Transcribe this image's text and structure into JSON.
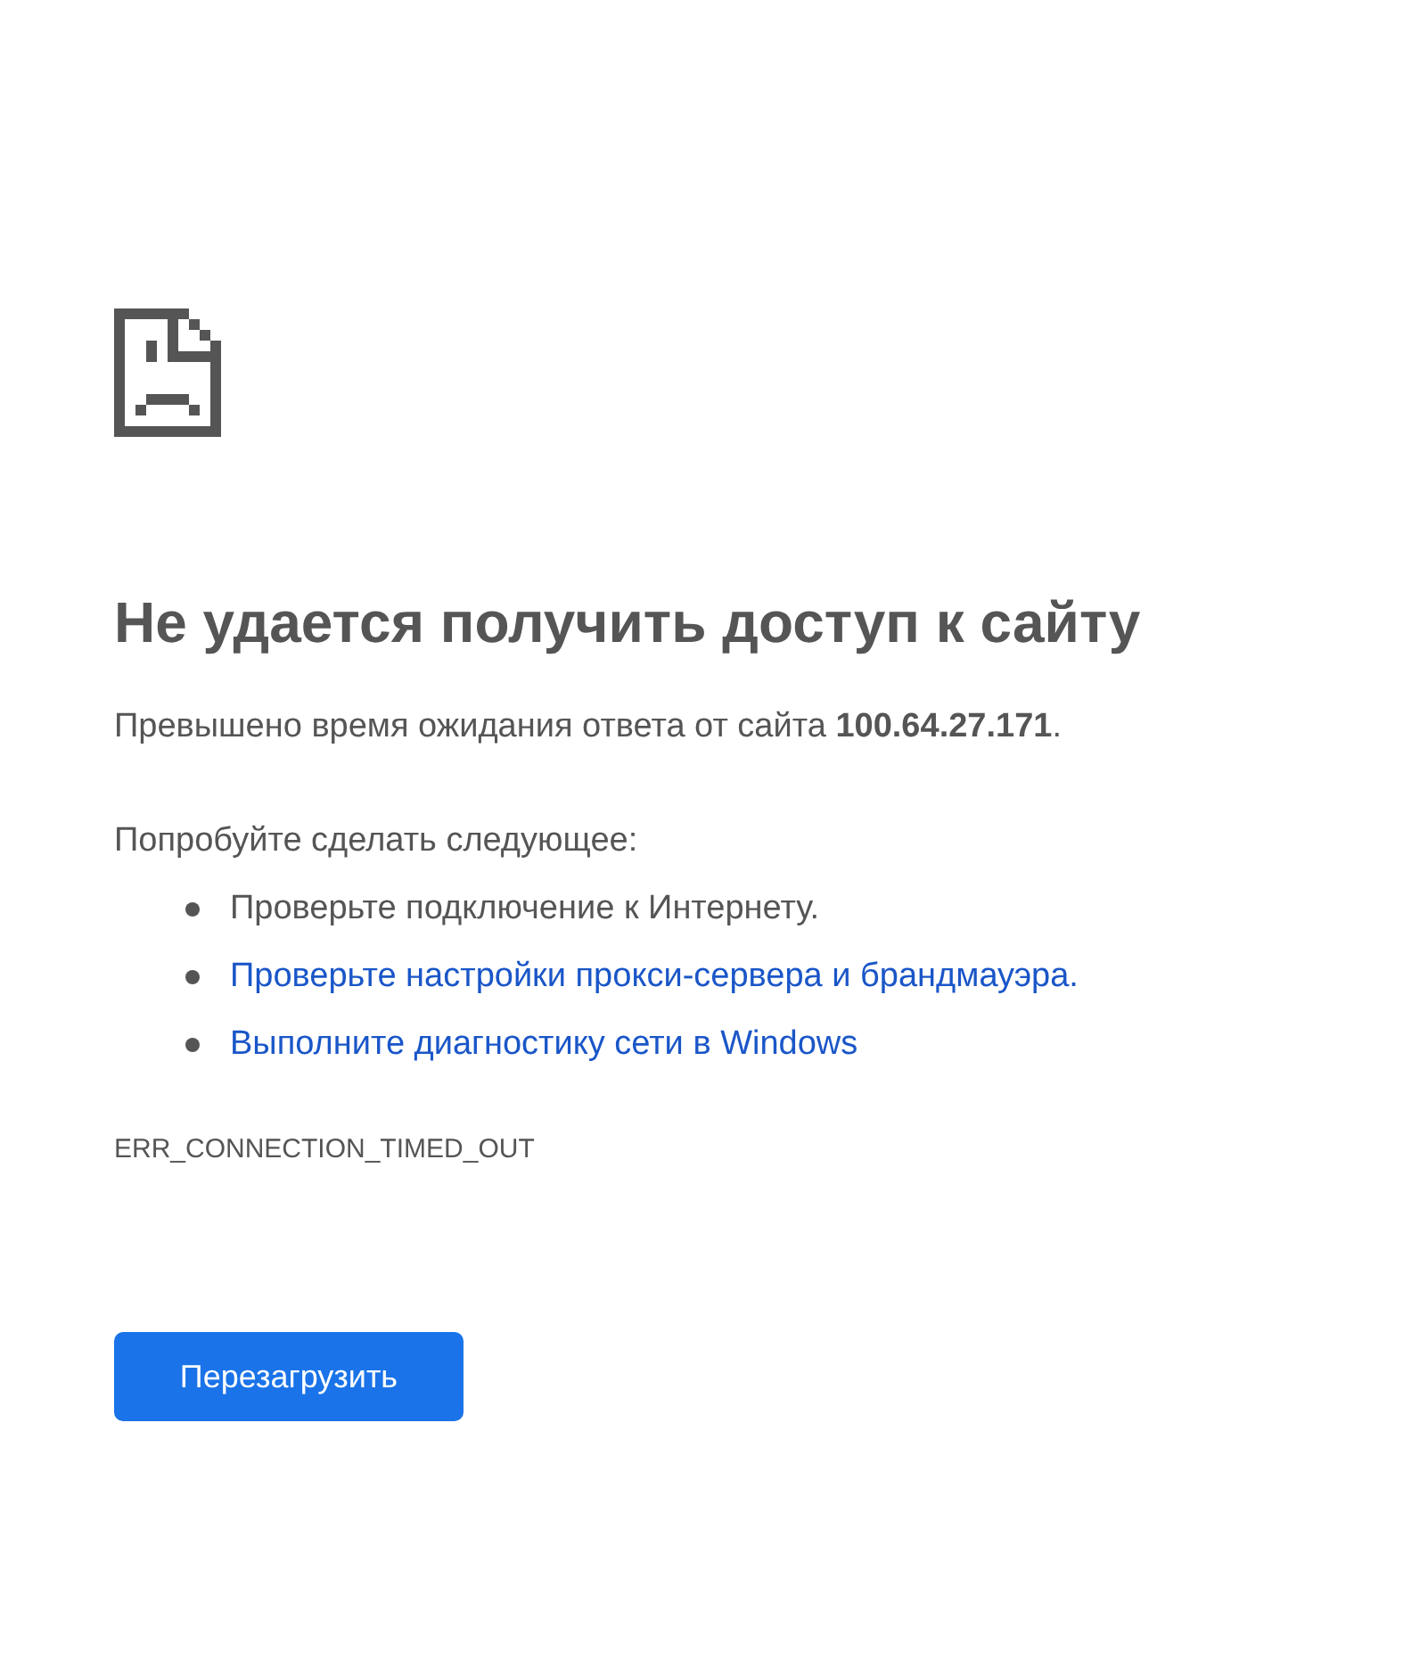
{
  "title": "Не удается получить доступ к сайту",
  "message": "Превышено время ожидания ответа от сайта **100.64.27.171**.",
  "suggestions_heading": "Попробуйте сделать следующее:",
  "suggestions": [
    {
      "kind": "text",
      "text": "Проверьте подключение к Интернету."
    },
    {
      "kind": "link",
      "text": "Проверьте настройки прокси-сервера и брандмауэра."
    },
    {
      "kind": "link",
      "text": "Выполните диагностику сети в Windows"
    }
  ],
  "error_code": "ERR_CONNECTION_TIMED_OUT",
  "button": "Перезагрузить"
}
